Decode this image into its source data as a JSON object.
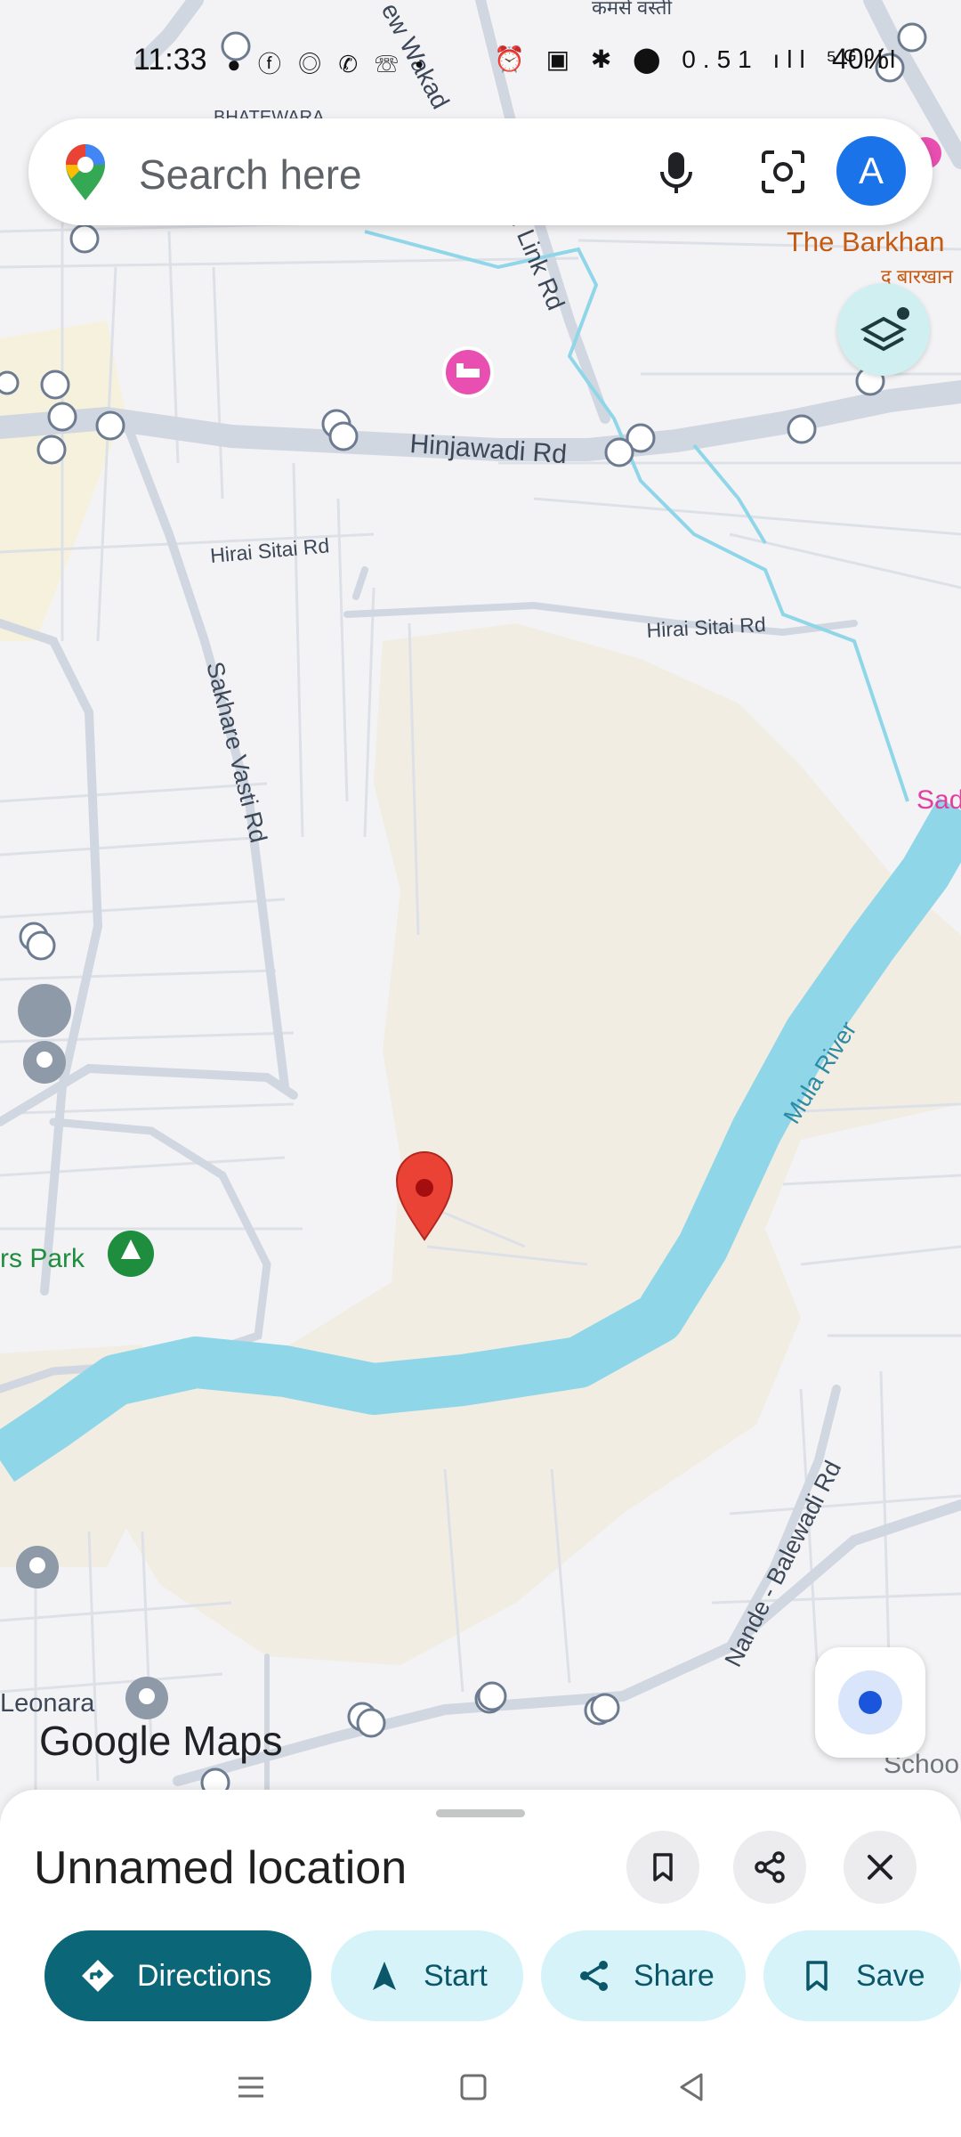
{
  "status_bar": {
    "time": "11:33",
    "notification_icons": "● ⓕ ◎ ✆ ☏ •",
    "system_icons": "⏰ ▣ ✱ ⬤ 0.51 ıll ⁵ᴳıll",
    "battery": "40%"
  },
  "search": {
    "placeholder": "Search here",
    "avatar_letter": "A"
  },
  "map": {
    "labels": {
      "area_top": "कमसे वस्ती",
      "area_left": "BHATEWARA",
      "wakad_road": "ew Wakad",
      "link_road": "i Link Rd",
      "hinjawadi": "Hinjawadi Rd",
      "hirai_1": "Hirai Sitai Rd",
      "hirai_2": "Hirai Sitai Rd",
      "sakhare": "Sakhare Vasti Rd",
      "mula": "Mula River",
      "nande": "Nande - Balewadi Rd",
      "barkhan_en": "The Barkhan",
      "barkhan_hi": "द बारखान",
      "sad": "Sad",
      "park": "rs Park",
      "leonara": "Leonara",
      "school": "Schoo"
    },
    "google_logo": "Google Maps",
    "colors": {
      "river": "#8fd6e9",
      "land": "#f1ede3",
      "road": "#d0d7e1",
      "pin": "#ea4335",
      "hotel": "#e94fb1",
      "park": "#1e8e3e"
    }
  },
  "place": {
    "title": "Unnamed location"
  },
  "actions": {
    "directions": "Directions",
    "start": "Start",
    "share": "Share",
    "save": "Save"
  }
}
